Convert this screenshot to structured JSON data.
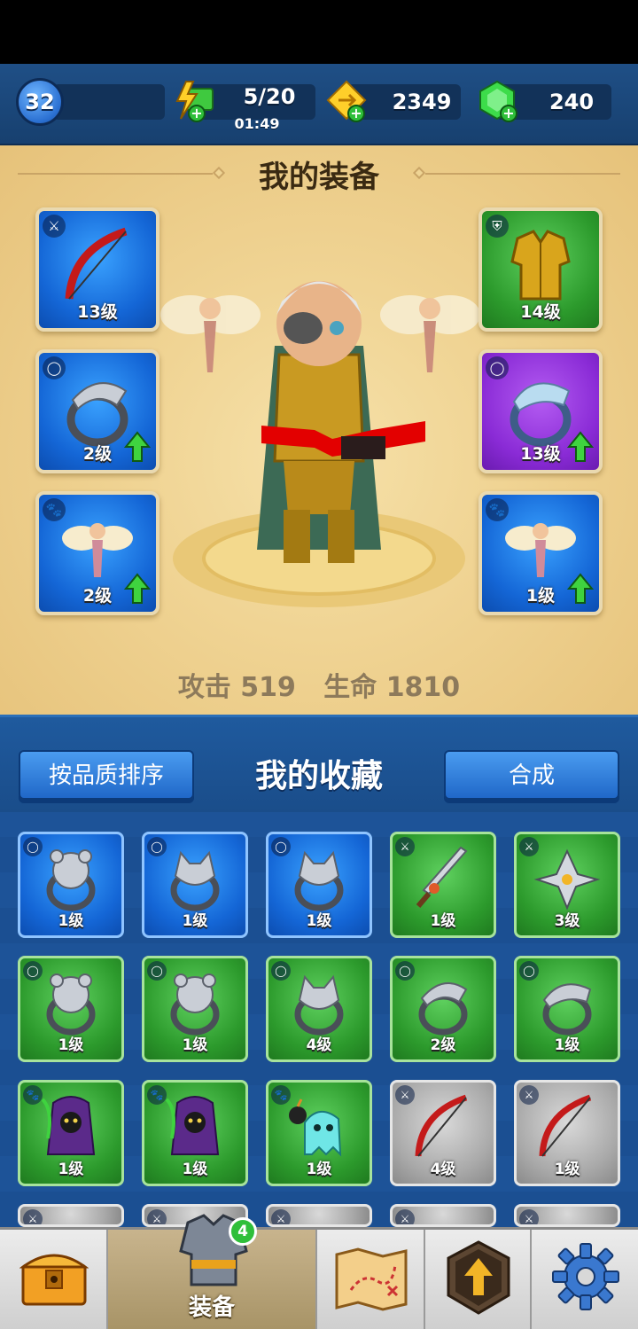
{
  "header": {
    "player_level": "32",
    "energy": "5/20",
    "energy_timer": "01:49",
    "gold": "2349",
    "gems": "240"
  },
  "equipment": {
    "title": "我的装备",
    "slots": [
      {
        "category": "weapon",
        "item": "red-bow-icon",
        "level": "13级",
        "rarity": "blue",
        "upgrade": false
      },
      {
        "category": "armor",
        "item": "golden-armor-icon",
        "level": "14级",
        "rarity": "green",
        "upgrade": false
      },
      {
        "category": "ring",
        "item": "eagle-ring-icon",
        "level": "2级",
        "rarity": "blue",
        "upgrade": true
      },
      {
        "category": "ring",
        "item": "serpent-ring-icon",
        "level": "13级",
        "rarity": "purple",
        "upgrade": true
      },
      {
        "category": "pet",
        "item": "fairy-icon",
        "level": "2级",
        "rarity": "blue",
        "upgrade": true
      },
      {
        "category": "pet",
        "item": "fairy-icon",
        "level": "1级",
        "rarity": "blue",
        "upgrade": true
      }
    ],
    "stats": {
      "attack_label": "攻击",
      "attack_value": "519",
      "hp_label": "生命",
      "hp_value": "1810"
    }
  },
  "collection": {
    "title": "我的收藏",
    "sort_button": "按品质排序",
    "merge_button": "合成",
    "items": [
      {
        "category": "ring",
        "item": "bear-ring-icon",
        "level": "1级",
        "rarity": "blue"
      },
      {
        "category": "ring",
        "item": "wolf-ring-icon",
        "level": "1级",
        "rarity": "blue"
      },
      {
        "category": "ring",
        "item": "wolf-ring-icon",
        "level": "1级",
        "rarity": "blue"
      },
      {
        "category": "weapon",
        "item": "serrated-sword-icon",
        "level": "1级",
        "rarity": "green"
      },
      {
        "category": "weapon",
        "item": "shuriken-icon",
        "level": "3级",
        "rarity": "green"
      },
      {
        "category": "ring",
        "item": "bear-ring-icon",
        "level": "1级",
        "rarity": "green"
      },
      {
        "category": "ring",
        "item": "bear-ring-icon",
        "level": "1级",
        "rarity": "green"
      },
      {
        "category": "ring",
        "item": "wolf-ring-icon",
        "level": "4级",
        "rarity": "green"
      },
      {
        "category": "ring",
        "item": "eagle-ring-icon",
        "level": "2级",
        "rarity": "green"
      },
      {
        "category": "ring",
        "item": "serpent-ring-icon",
        "level": "1级",
        "rarity": "green"
      },
      {
        "category": "pet",
        "item": "reaper-pet-icon",
        "level": "1级",
        "rarity": "green"
      },
      {
        "category": "pet",
        "item": "reaper-pet-icon",
        "level": "1级",
        "rarity": "green"
      },
      {
        "category": "pet",
        "item": "ghost-bomb-pet-icon",
        "level": "1级",
        "rarity": "green"
      },
      {
        "category": "weapon",
        "item": "red-bow-icon",
        "level": "4级",
        "rarity": "gray"
      },
      {
        "category": "weapon",
        "item": "red-bow-icon",
        "level": "1级",
        "rarity": "gray"
      }
    ]
  },
  "bottom_nav": {
    "items": [
      {
        "name": "shop",
        "icon": "treasure-chest-icon",
        "label": ""
      },
      {
        "name": "equipment",
        "icon": "armor-icon",
        "label": "装备",
        "badge": "4"
      },
      {
        "name": "map",
        "icon": "treasure-map-icon",
        "label": ""
      },
      {
        "name": "talents",
        "icon": "upgrade-arrow-icon",
        "label": ""
      },
      {
        "name": "settings",
        "icon": "gear-icon",
        "label": ""
      }
    ]
  },
  "colors": {
    "blue": "#1466d6",
    "green": "#2c9a2c",
    "purple": "#8a2bd6",
    "gray": "#9a9a9a",
    "gold_panel": "#f0d494"
  }
}
